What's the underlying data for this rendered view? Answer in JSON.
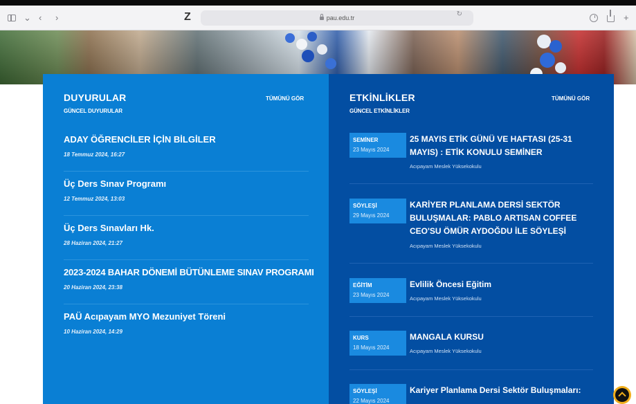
{
  "browser": {
    "url": "pau.edu.tr",
    "logo": "Z",
    "icons": [
      "sidebar-icon",
      "chevron-down-icon",
      "back-icon",
      "forward-icon",
      "lock-icon",
      "reload-icon",
      "download-icon",
      "share-icon",
      "plus-icon"
    ]
  },
  "announcements": {
    "title": "DUYURULAR",
    "subtitle": "GÜNCEL DUYURULAR",
    "see_all": "TÜMÜNÜ GÖR",
    "items": [
      {
        "title": "ADAY ÖĞRENCİLER İÇİN BİLGİLER",
        "date": "18 Temmuz 2024, 16:27"
      },
      {
        "title": "Üç Ders Sınav Programı",
        "date": "12 Temmuz 2024, 13:03"
      },
      {
        "title": "Üç Ders Sınavları Hk.",
        "date": "28 Haziran 2024, 21:27"
      },
      {
        "title": "2023-2024 BAHAR DÖNEMİ BÜTÜNLEME SINAV PROGRAMI",
        "date": "20 Haziran 2024, 23:38"
      },
      {
        "title": "PAÜ Acıpayam MYO Mezuniyet Töreni",
        "date": "10 Haziran 2024, 14:29"
      }
    ]
  },
  "events": {
    "title": "ETKİNLİKLER",
    "subtitle": "GÜNCEL ETKİNLİKLER",
    "see_all": "TÜMÜNÜ GÖR",
    "items": [
      {
        "category": "SEMİNER",
        "date": "23 Mayıs 2024",
        "title": "25 MAYIS ETİK GÜNÜ VE HAFTASI (25-31 MAYIS) : ETİK KONULU SEMİNER",
        "org": "Acıpayam Meslek Yüksekokulu"
      },
      {
        "category": "SÖYLEŞİ",
        "date": "29 Mayıs 2024",
        "title": "KARİYER PLANLAMA DERSİ SEKTÖR BULUŞMALAR: PABLO ARTISAN COFFEE CEO'SU ÖMÜR AYDOĞDU İLE SÖYLEŞİ",
        "org": "Acıpayam Meslek Yüksekokulu"
      },
      {
        "category": "EĞİTİM",
        "date": "23 Mayıs 2024",
        "title": "Evlilik Öncesi Eğitim",
        "org": "Acıpayam Meslek Yüksekokulu"
      },
      {
        "category": "KURS",
        "date": "18 Mayıs 2024",
        "title": "MANGALA KURSU",
        "org": "Acıpayam Meslek Yüksekokulu"
      },
      {
        "category": "SÖYLEŞİ",
        "date": "22 Mayıs 2024",
        "title": "Kariyer Planlama Dersi Sektör Buluşmaları:",
        "org": ""
      }
    ]
  },
  "scroll_top": {
    "icon": "chevron-up-icon"
  }
}
